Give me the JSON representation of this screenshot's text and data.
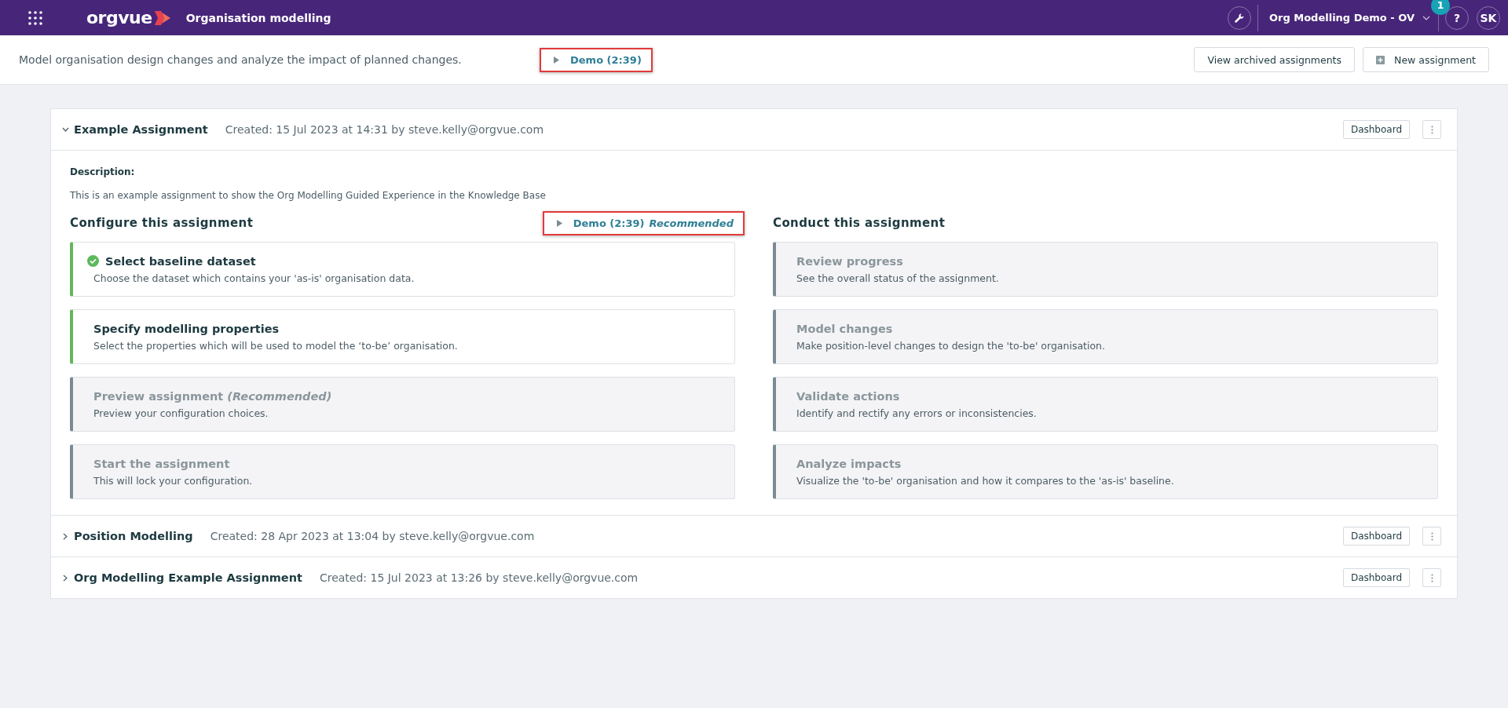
{
  "app_bar": {
    "logo_text": "orgvue",
    "product": "Organisation modelling",
    "workspace": "Org Modelling Demo - OV",
    "notification_count": "1",
    "help": "?",
    "user_initials": "SK"
  },
  "page_header": {
    "description": "Model organisation design changes and analyze the impact of planned changes.",
    "demo_link": {
      "label": "Demo (2:39)",
      "highlighted": true
    },
    "buttons": [
      {
        "label": "View archived assignments",
        "kind": "plain"
      },
      {
        "label": "New assignment",
        "kind": "add"
      }
    ]
  },
  "assignments": [
    {
      "title": "Example Assignment",
      "created": "Created: 15 Jul 2023 at 14:31 by steve.kelly@orgvue.com",
      "expanded": true,
      "dashboard": "Dashboard",
      "description_label": "Description:",
      "description": "This is an example assignment to show the Org Modelling Guided Experience in the Knowledge Base",
      "configure": {
        "heading": "Configure this assignment",
        "demo_link": {
          "label": "Demo (2:39)",
          "note": "Recommended",
          "highlighted": true
        },
        "steps": [
          {
            "title": "Select baseline dataset",
            "text": "Choose the dataset which contains your 'as-is' organisation data.",
            "completed": true,
            "disabled": false
          },
          {
            "title": "Specify modelling properties",
            "text": "Select the properties which will be used to model the ‘to-be’ organisation.",
            "completed": false,
            "disabled": false
          },
          {
            "title": "Preview assignment *(Recommended)*",
            "text": "Preview your configuration choices.",
            "completed": false,
            "disabled": true
          },
          {
            "title": "Start the assignment",
            "text": "This will lock your configuration.",
            "completed": false,
            "disabled": true
          }
        ]
      },
      "conduct": {
        "heading": "Conduct this assignment",
        "steps": [
          {
            "title": "Review progress",
            "text": "See the overall status of the assignment.",
            "completed": false,
            "disabled": true
          },
          {
            "title": "Model changes",
            "text": "Make position-level changes to design the 'to-be' organisation.",
            "completed": false,
            "disabled": true
          },
          {
            "title": "Validate actions",
            "text": "Identify and rectify any errors or inconsistencies.",
            "completed": false,
            "disabled": true
          },
          {
            "title": "Analyze impacts",
            "text": "Visualize the 'to-be' organisation and how it compares to the 'as-is' baseline.",
            "completed": false,
            "disabled": true
          }
        ]
      }
    },
    {
      "title": "Position Modelling",
      "created": "Created: 28 Apr 2023 at 13:04 by steve.kelly@orgvue.com",
      "expanded": false,
      "dashboard": "Dashboard"
    },
    {
      "title": "Org Modelling Example Assignment",
      "created": "Created: 15 Jul 2023 at 13:26 by steve.kelly@orgvue.com",
      "expanded": false,
      "dashboard": "Dashboard"
    }
  ]
}
